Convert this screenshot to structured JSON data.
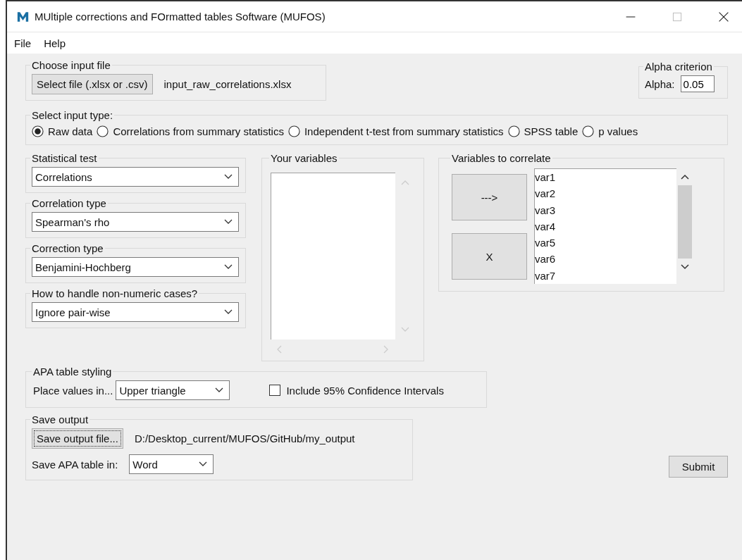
{
  "window": {
    "title": "MUltiple corrections and FOrmatted tables Software (MUFOS)"
  },
  "menu": [
    "File",
    "Help"
  ],
  "input_file": {
    "title": "Choose input file",
    "button": "Select file (.xlsx or .csv)",
    "filename": "input_raw_correlations.xlsx"
  },
  "alpha": {
    "title": "Alpha criterion",
    "label": "Alpha:",
    "value": "0.05"
  },
  "input_type": {
    "title": "Select input type:",
    "options": [
      {
        "label": "Raw data",
        "selected": true
      },
      {
        "label": "Correlations from summary statistics",
        "selected": false
      },
      {
        "label": "Independent t-test from summary statistics",
        "selected": false
      },
      {
        "label": "SPSS table",
        "selected": false
      },
      {
        "label": "p values",
        "selected": false
      }
    ]
  },
  "settings": [
    {
      "title": "Statistical test",
      "value": "Correlations"
    },
    {
      "title": "Correlation type",
      "value": "Spearman's rho"
    },
    {
      "title": "Correction type",
      "value": "Benjamini-Hochberg"
    },
    {
      "title": "How to handle non-numeric cases?",
      "value": "Ignore pair-wise"
    }
  ],
  "your_variables": {
    "title": "Your variables"
  },
  "variables_to_correlate": {
    "title": "Variables to correlate",
    "add_button": "--->",
    "remove_button": "X",
    "items": [
      "var1",
      "var2",
      "var3",
      "var4",
      "var5",
      "var6",
      "var7"
    ]
  },
  "apa": {
    "title": "APA table styling",
    "place_label": "Place values in...",
    "place_value": "Upper triangle",
    "ci": {
      "label": "Include 95% Confidence Intervals",
      "checked": false
    }
  },
  "save": {
    "title": "Save output",
    "button": "Save output file...",
    "focused": true,
    "path": "D:/Desktop_current/MUFOS/GitHub/my_output",
    "format_label": "Save APA table in:",
    "format_value": "Word"
  },
  "submit": "Submit"
}
